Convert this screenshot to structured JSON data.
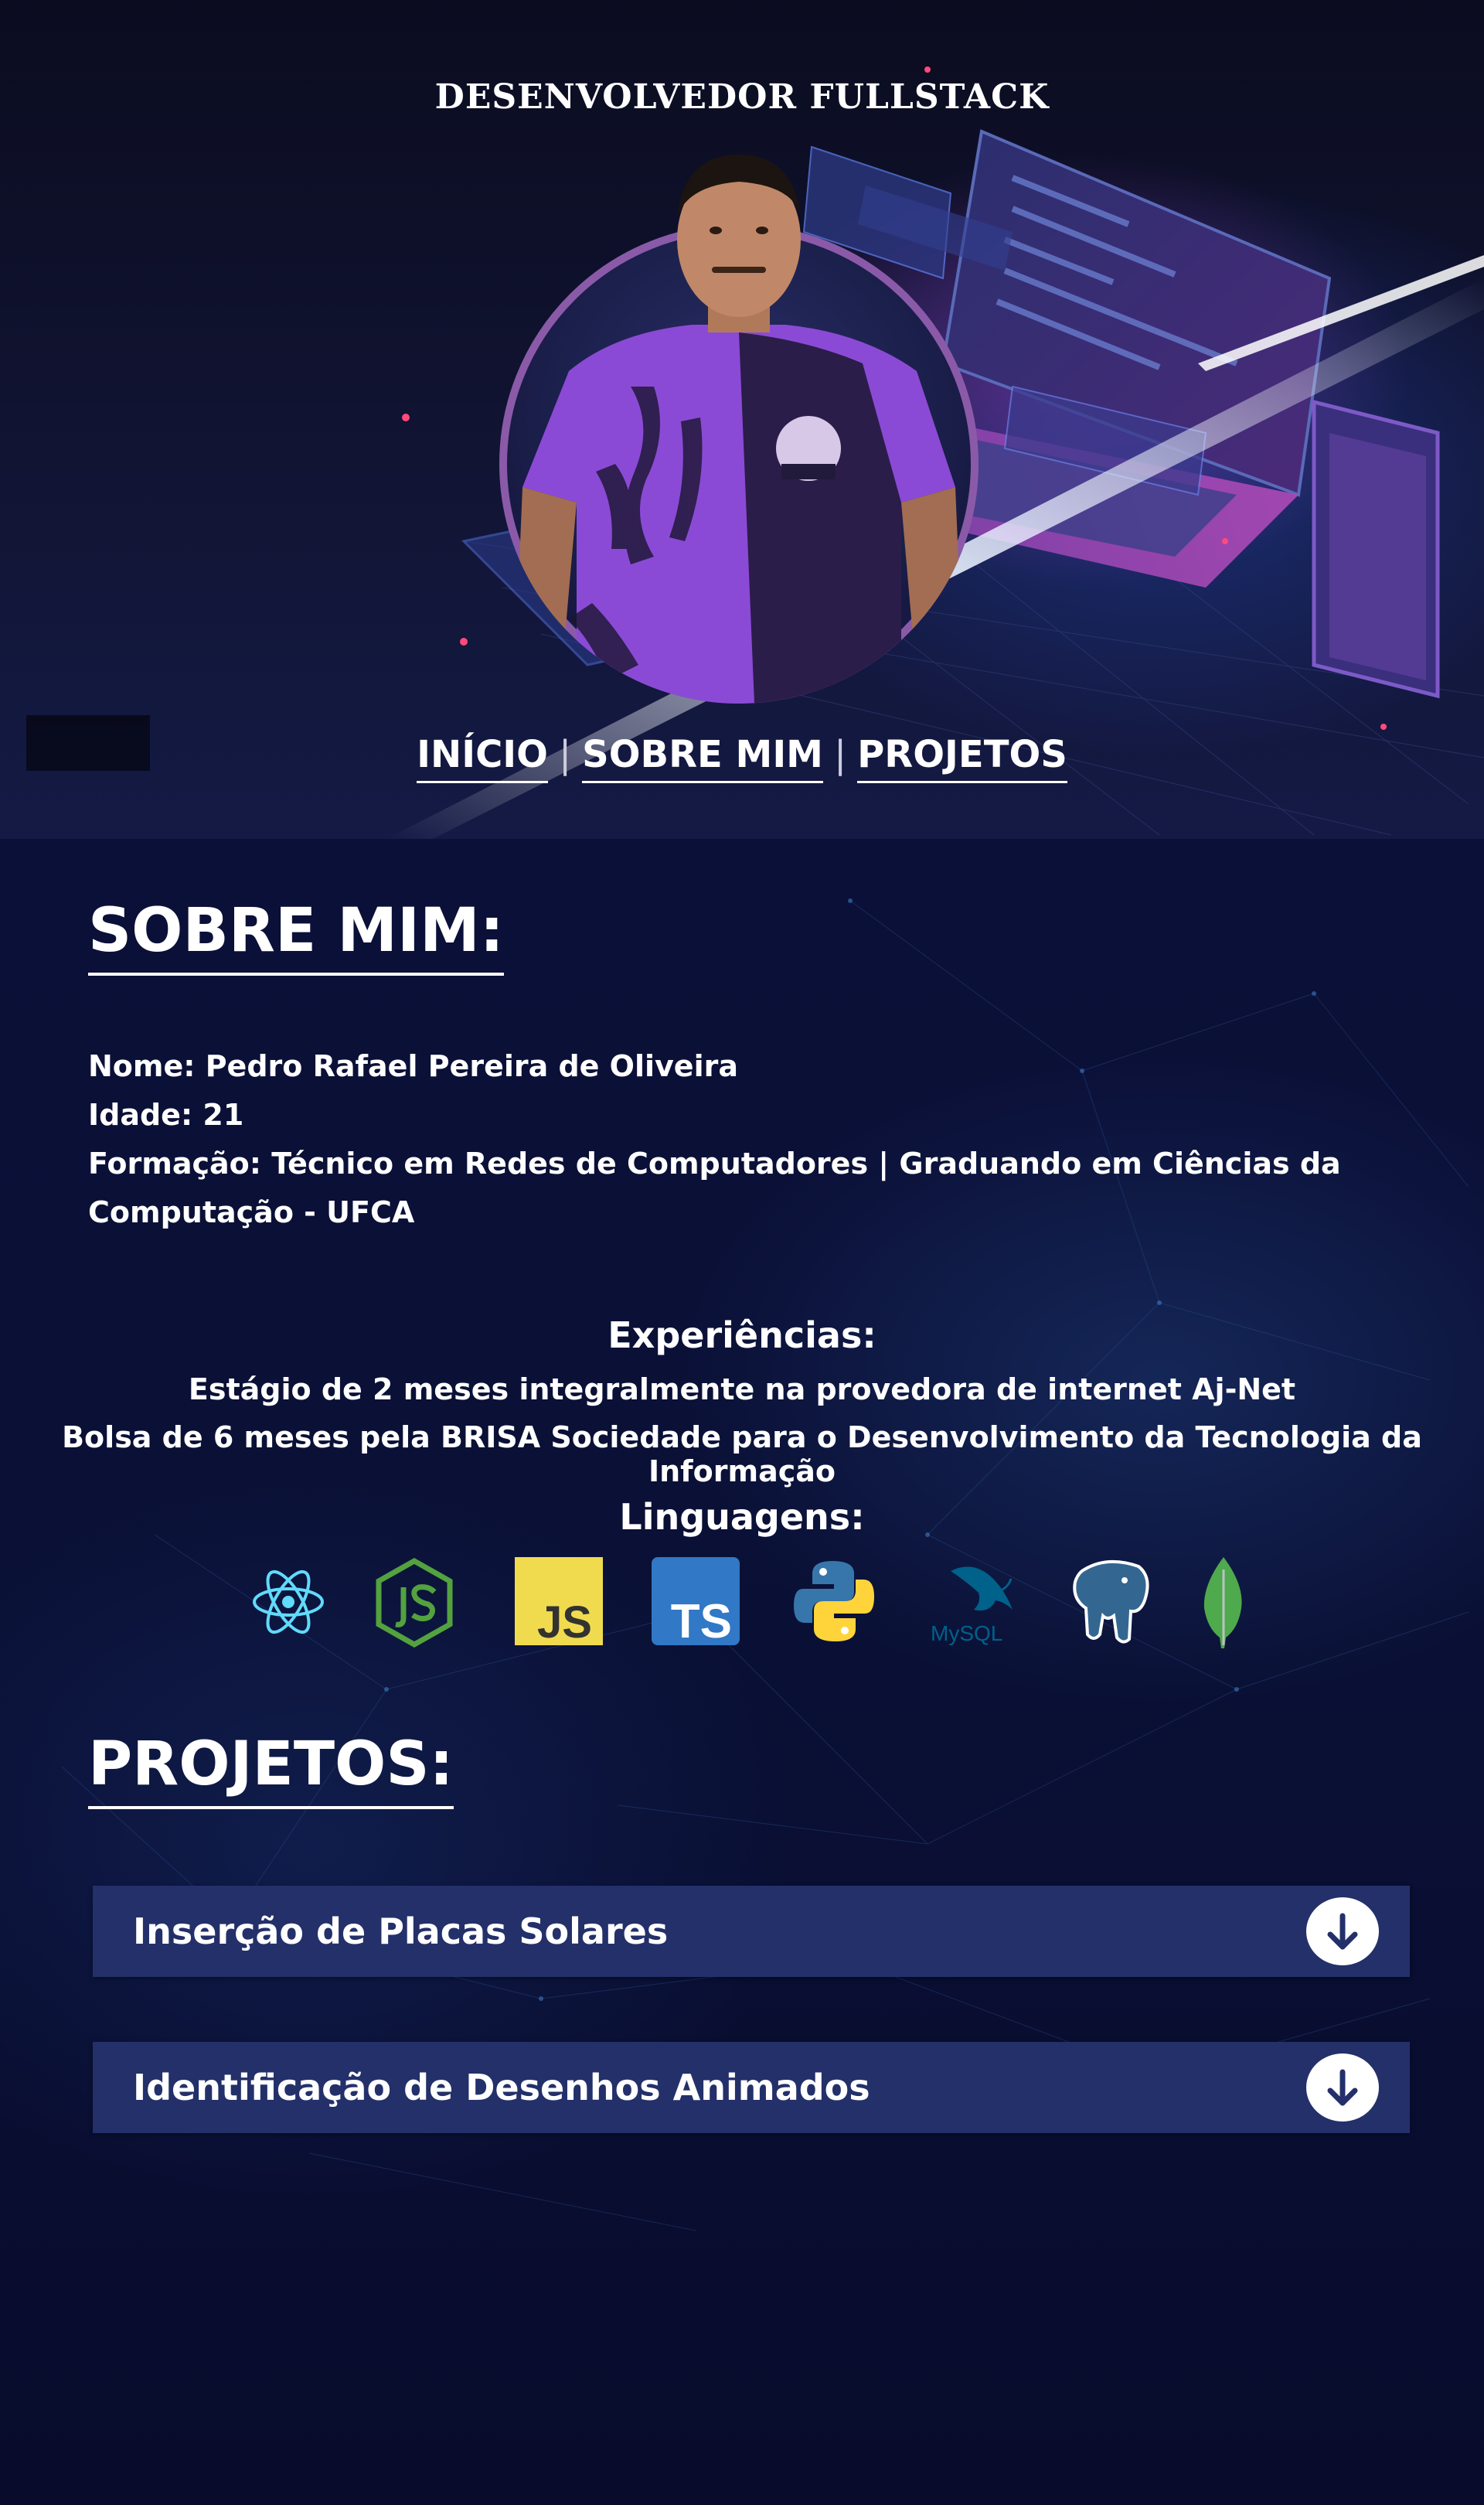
{
  "hero": {
    "title": "DESENVOLVEDOR FULLSTACK",
    "nav": [
      {
        "label": "INÍCIO"
      },
      {
        "label": "SOBRE MIM"
      },
      {
        "label": "PROJETOS"
      }
    ],
    "nav_separator": "|"
  },
  "about": {
    "title": "SOBRE MIM:",
    "name": "Nome: Pedro Rafael Pereira de Oliveira",
    "age": "Idade: 21",
    "education": "Formação: Técnico em Redes de Computadores | Graduando em Ciências da Computação - UFCA"
  },
  "experiences": {
    "title": "Experiências:",
    "items": [
      "Estágio de 2 meses integralmente na provedora de internet Aj-Net",
      "Bolsa de 6 meses pela BRISA Sociedade para o Desenvolvimento da Tecnologia da Informação"
    ]
  },
  "languages": {
    "title": "Linguagens:",
    "icons": [
      "react-icon",
      "nodejs-icon",
      "javascript-icon",
      "typescript-icon",
      "python-icon",
      "mysql-icon",
      "postgresql-icon",
      "mongodb-icon"
    ],
    "js_text": "JS",
    "ts_text": "TS",
    "mysql_text": "MySQL"
  },
  "projects": {
    "title": "PROJETOS:",
    "items": [
      {
        "label": "Inserção de Placas Solares"
      },
      {
        "label": "Identificação de Desenhos Animados"
      }
    ]
  },
  "colors": {
    "accordion_bg": "#23306a",
    "avatar_ring": "#8a5aa8",
    "page_bg": "#0a0f33"
  }
}
